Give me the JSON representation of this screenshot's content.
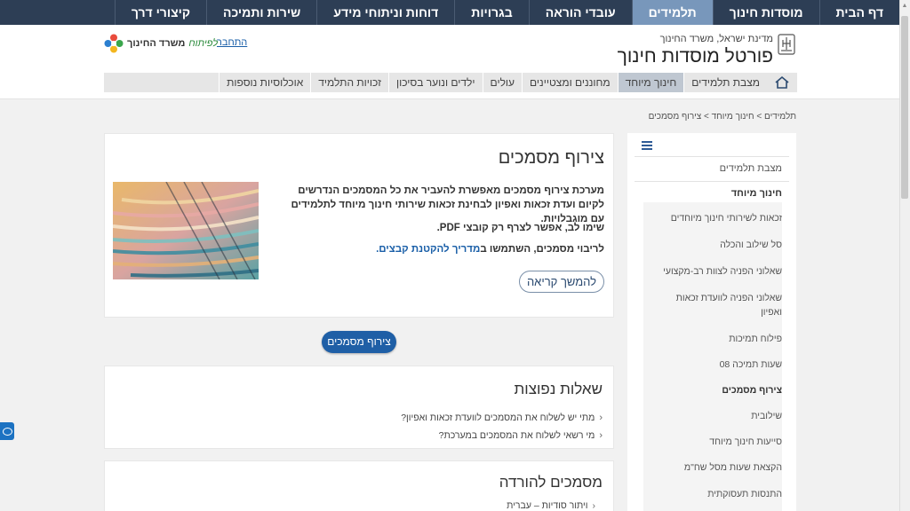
{
  "topnav": {
    "items": [
      {
        "label": "דף הבית",
        "active": false
      },
      {
        "label": "מוסדות חינוך",
        "active": false
      },
      {
        "label": "תלמידים",
        "active": true
      },
      {
        "label": "עובדי הוראה",
        "active": false
      },
      {
        "label": "בגרויות",
        "active": false
      },
      {
        "label": "דוחות וניתוחי מידע",
        "active": false
      },
      {
        "label": "שירות ותמיכה",
        "active": false
      },
      {
        "label": "קיצורי דרך",
        "active": false
      }
    ]
  },
  "header": {
    "state_name": "מדינת ישראל, משרד החינוך",
    "portal_title": "פורטל מוסדות חינוך",
    "connect_link": "התחבר",
    "ministry_name": "משרד החינוך",
    "ministry_script": "לפיתוח"
  },
  "subnav": {
    "items": [
      {
        "label": "מצבת תלמידים",
        "active": false
      },
      {
        "label": "חינוך מיוחד",
        "active": true
      },
      {
        "label": "מחוננים ומצטיינים",
        "active": false
      },
      {
        "label": "עולים",
        "active": false
      },
      {
        "label": "ילדים ונוער בסיכון",
        "active": false
      },
      {
        "label": "זכויות התלמיד",
        "active": false
      },
      {
        "label": "אוכלוסיות נוספות",
        "active": false
      }
    ]
  },
  "breadcrumb": "תלמידים > חינוך מיוחד > צירוף מסמכים",
  "sidebar": {
    "top_link": "מצבת תלמידים",
    "section": "חינוך מיוחד",
    "items": [
      {
        "label": "זכאות לשירותי חינוך מיוחדים",
        "current": false
      },
      {
        "label": "סל שילוב והכלה",
        "current": false
      },
      {
        "label": "שאלוני הפניה לצוות רב-מקצועי",
        "current": false
      },
      {
        "label": "שאלוני הפניה לוועדת זכאות ואפיון",
        "current": false
      },
      {
        "label": "פילוח תמיכות",
        "current": false
      },
      {
        "label": "שעות תמיכה 08",
        "current": false
      },
      {
        "label": "צירוף מסמכים",
        "current": true
      },
      {
        "label": "שילובית",
        "current": false
      },
      {
        "label": "סייעות חינוך מיוחד",
        "current": false
      },
      {
        "label": "הקצאת שעות מסל שח\"מ",
        "current": false
      },
      {
        "label": "התנסות תעסוקתית",
        "current": false
      }
    ]
  },
  "main": {
    "title": "צירוף מסמכים",
    "para1": "מערכת צירוף מסמכים מאפשרת להעביר את כל המסמכים הנדרשים לקיום ועדת זכאות ואפיון לבחינת זכאות שירותי חינוך מיוחד לתלמידים עם מוגבלויות.",
    "para2": "שימו לב, אפשר לצרף רק קובצי PDF.",
    "para3_prefix": "לריבוי מסמכים, השתמשו ב",
    "para3_link": "מדריך להקטנת קבצים.",
    "more_button": "להמשך קריאה",
    "attach_button": "צירוף מסמכים"
  },
  "faq": {
    "title": "שאלות נפוצות",
    "questions": [
      "מתי יש לשלוח את המסמכים לוועדת זכאות ואפיון?",
      "מי רשאי לשלוח את המסמכים במערכת?"
    ]
  },
  "downloads": {
    "title": "מסמכים להורדה",
    "items": [
      "ויתור סודיות – עברית"
    ]
  }
}
